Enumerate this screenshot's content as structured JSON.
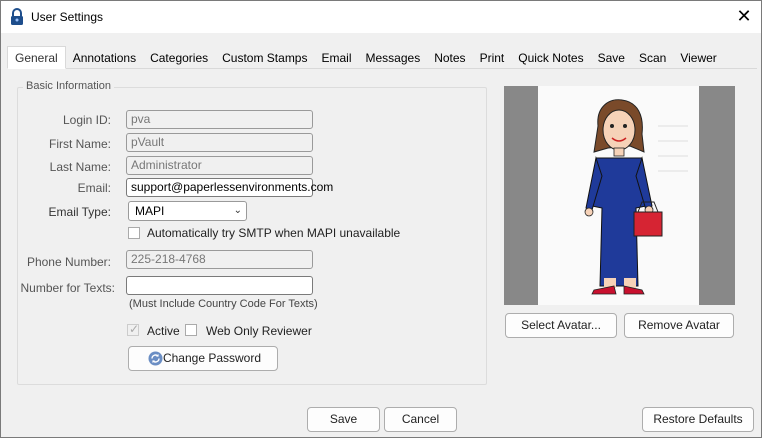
{
  "window": {
    "title": "User Settings"
  },
  "tabs": [
    "General",
    "Annotations",
    "Categories",
    "Custom Stamps",
    "Email",
    "Messages",
    "Notes",
    "Print",
    "Quick Notes",
    "Save",
    "Scan",
    "Viewer"
  ],
  "basic_info": {
    "group_label": "Basic Information",
    "login_id_label": "Login ID:",
    "login_id_value": "pva",
    "first_name_label": "First Name:",
    "first_name_value": "pVault",
    "last_name_label": "Last Name:",
    "last_name_value": "Administrator",
    "email_label": "Email:",
    "email_value": "support@paperlessenvironments.com",
    "email_type_label": "Email Type:",
    "email_type_value": "MAPI",
    "smtp_fallback_label": "Automatically try SMTP when MAPI unavailable",
    "smtp_fallback_checked": false,
    "phone_label": "Phone Number:",
    "phone_value": "225-218-4768",
    "texts_label": "Number for Texts:",
    "texts_value": "",
    "texts_hint": "(Must Include Country Code For Texts)",
    "active_label": "Active",
    "active_checked": true,
    "web_only_label": "Web Only Reviewer",
    "web_only_checked": false,
    "change_password_label": "Change Password"
  },
  "avatar": {
    "select_label": "Select Avatar...",
    "remove_label": "Remove Avatar"
  },
  "footer": {
    "save_label": "Save",
    "cancel_label": "Cancel",
    "restore_label": "Restore Defaults"
  },
  "colors": {
    "dress": "#1f3a9a",
    "bag": "#d62433",
    "hair": "#7a4a2a",
    "frame": "#888888"
  },
  "icons": {
    "title": "lock-icon",
    "close": "close-icon",
    "dropdown": "chevron-down-icon",
    "password": "refresh-icon"
  }
}
